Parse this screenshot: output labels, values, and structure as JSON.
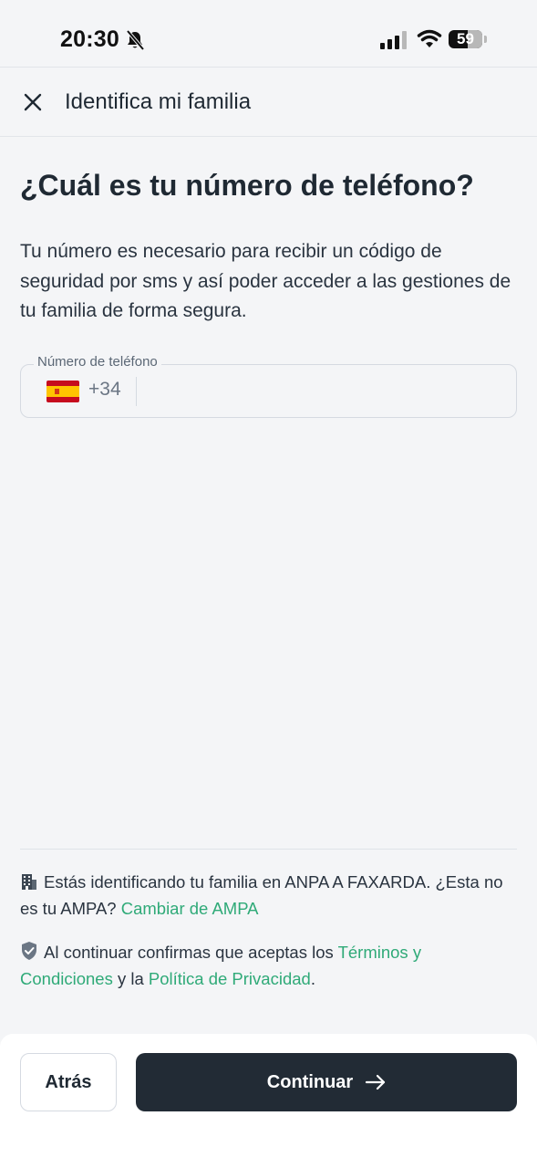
{
  "status_bar": {
    "time": "20:30",
    "battery": "59",
    "icons": [
      "bell-slash-icon",
      "signal-icon",
      "wifi-icon",
      "battery-icon"
    ]
  },
  "header": {
    "title": "Identifica mi familia",
    "close_icon": "close-icon"
  },
  "main": {
    "title": "¿Cuál es tu número de teléfono?",
    "description": "Tu número es necesario para recibir un código de seguridad por sms y así poder acceder a las gestiones de tu familia de forma segura.",
    "phone_field": {
      "label": "Número de teléfono",
      "country_code": "+34",
      "country_flag": "spain-flag-icon",
      "value": "",
      "placeholder": ""
    }
  },
  "info": {
    "ampa_icon": "building-icon",
    "ampa_text": "Estás identificando tu familia en ANPA A FAXARDA. ¿Esta no es tu AMPA?",
    "ampa_link": "Cambiar de AMPA",
    "terms_icon": "shield-check-icon",
    "terms_prefix": "Al continuar confirmas que aceptas los",
    "terms_link": "Términos y Condiciones",
    "terms_middle": "y la",
    "privacy_link": "Política de Privacidad",
    "terms_suffix": ".",
    "link_color": "#2faa78"
  },
  "footer": {
    "back_label": "Atrás",
    "continue_label": "Continuar",
    "continue_icon": "arrow-right-icon",
    "continue_color": "#222b35"
  }
}
